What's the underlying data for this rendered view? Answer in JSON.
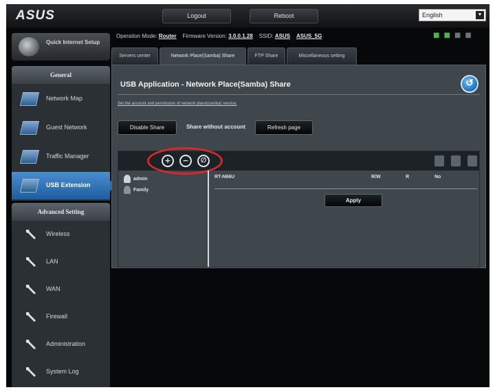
{
  "topbar": {
    "logo": "ASUS",
    "logout": "Logout",
    "reboot": "Reboot",
    "language": "English"
  },
  "status": {
    "mode_label": "Operation Mode:",
    "mode_value": "Router",
    "fw_label": "Firmware Version:",
    "fw_value": "3.0.0.1.28",
    "ssid_label": "SSID:",
    "ssid_1": "ASUS",
    "ssid_2": "ASUS_5G"
  },
  "sidebar": {
    "quick_setup": "Quick Internet Setup",
    "general_heading": "General",
    "general_items": [
      {
        "label": "Network Map"
      },
      {
        "label": "Guest Network"
      },
      {
        "label": "Traffic Manager"
      },
      {
        "label": "USB Extension"
      }
    ],
    "advanced_heading": "Advanced Setting",
    "advanced_items": [
      {
        "label": "Wireless"
      },
      {
        "label": "LAN"
      },
      {
        "label": "WAN"
      },
      {
        "label": "Firewall"
      },
      {
        "label": "Administration"
      },
      {
        "label": "System Log"
      }
    ]
  },
  "tabs": [
    {
      "label": "Servers center"
    },
    {
      "label": "Network Place(Samba) Share"
    },
    {
      "label": "FTP Share"
    },
    {
      "label": "Miscellaneous setting"
    }
  ],
  "panel": {
    "title": "USB Application - Network Place(Samba) Share",
    "description": "Set the account and permission of network place(samba) service.",
    "disable_share": "Disable Share",
    "share_without_account": "Share without account",
    "refresh_page": "Refresh page"
  },
  "share": {
    "add_symbol": "+",
    "remove_symbol": "−",
    "edit_symbol": "∅",
    "users": [
      {
        "name": "admin"
      },
      {
        "name": "Family"
      }
    ],
    "device": "RT-N66U",
    "col_rw": "R/W",
    "col_r": "R",
    "col_no": "No",
    "apply": "Apply"
  },
  "colors": {
    "highlight": "#d62a2a",
    "active_item": "#2a6eb2",
    "status_icons": "#48b84a"
  }
}
